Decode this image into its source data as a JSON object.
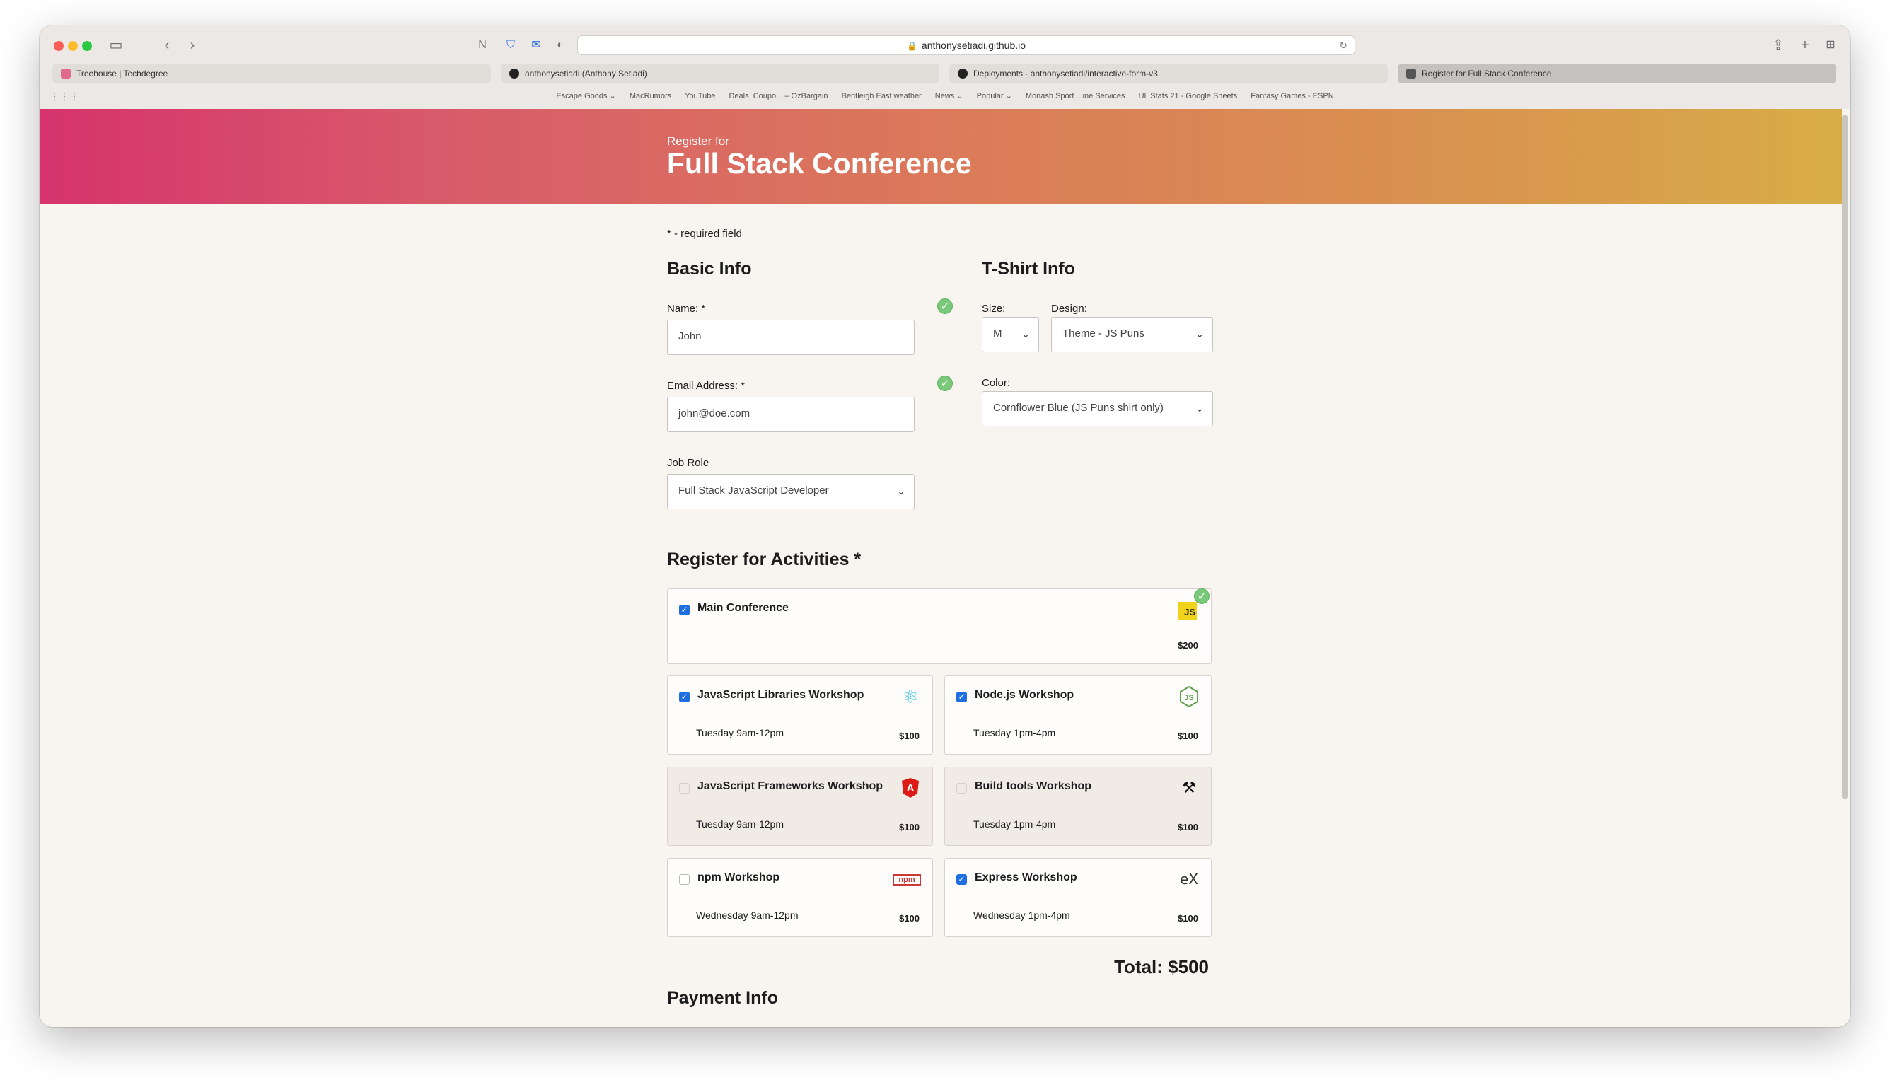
{
  "browser": {
    "url": "anthonysetiadi.github.io",
    "tabs": [
      {
        "label": "Treehouse | Techdegree"
      },
      {
        "label": "anthonysetiadi (Anthony Setiadi)"
      },
      {
        "label": "Deployments · anthonysetiadi/interactive-form-v3"
      },
      {
        "label": "Register for Full Stack Conference"
      }
    ],
    "bookmarks": [
      "Escape Goods ⌄",
      "MacRumors",
      "YouTube",
      "Deals, Coupo... – OzBargain",
      "Bentleigh East weather",
      "News ⌄",
      "Popular ⌄",
      "Monash Sport ...ine Services",
      "UL Stats 21 - Google Sheets",
      "Fantasy Games - ESPN"
    ]
  },
  "header": {
    "subtitle": "Register for",
    "title": "Full Stack Conference"
  },
  "form": {
    "required_note": "* - required field",
    "basic_info": {
      "title": "Basic Info",
      "name_label": "Name: *",
      "name_value": "John",
      "email_label": "Email Address: *",
      "email_value": "john@doe.com",
      "job_label": "Job Role",
      "job_value": "Full Stack JavaScript Developer"
    },
    "tshirt_info": {
      "title": "T-Shirt Info",
      "size_label": "Size:",
      "size_value": "M",
      "design_label": "Design:",
      "design_value": "Theme - JS Puns",
      "color_label": "Color:",
      "color_value": "Cornflower Blue (JS Puns shirt only)"
    },
    "activities": {
      "title": "Register for Activities *",
      "items": [
        {
          "title": "Main Conference",
          "when": "",
          "price": "$200",
          "checked": true,
          "icon": "js-logo-icon"
        },
        {
          "title": "JavaScript Libraries Workshop",
          "when": "Tuesday 9am-12pm",
          "price": "$100",
          "checked": true,
          "icon": "react-icon"
        },
        {
          "title": "Node.js Workshop",
          "when": "Tuesday 1pm-4pm",
          "price": "$100",
          "checked": true,
          "icon": "nodejs-icon"
        },
        {
          "title": "JavaScript Frameworks Workshop",
          "when": "Tuesday 9am-12pm",
          "price": "$100",
          "checked": false,
          "icon": "angular-icon"
        },
        {
          "title": "Build tools Workshop",
          "when": "Tuesday 1pm-4pm",
          "price": "$100",
          "checked": false,
          "icon": "tools-icon"
        },
        {
          "title": "npm Workshop",
          "when": "Wednesday 9am-12pm",
          "price": "$100",
          "checked": false,
          "icon": "npm-icon"
        },
        {
          "title": "Express Workshop",
          "when": "Wednesday 1pm-4pm",
          "price": "$100",
          "checked": true,
          "icon": "express-icon"
        }
      ],
      "total": "Total: $500"
    },
    "payment_title": "Payment Info"
  },
  "colors": {
    "gradient_start": "#d6336c",
    "gradient_end": "#d8ad47",
    "check_green": "#7ac97a",
    "checkbox_blue": "#1f6fe0"
  }
}
